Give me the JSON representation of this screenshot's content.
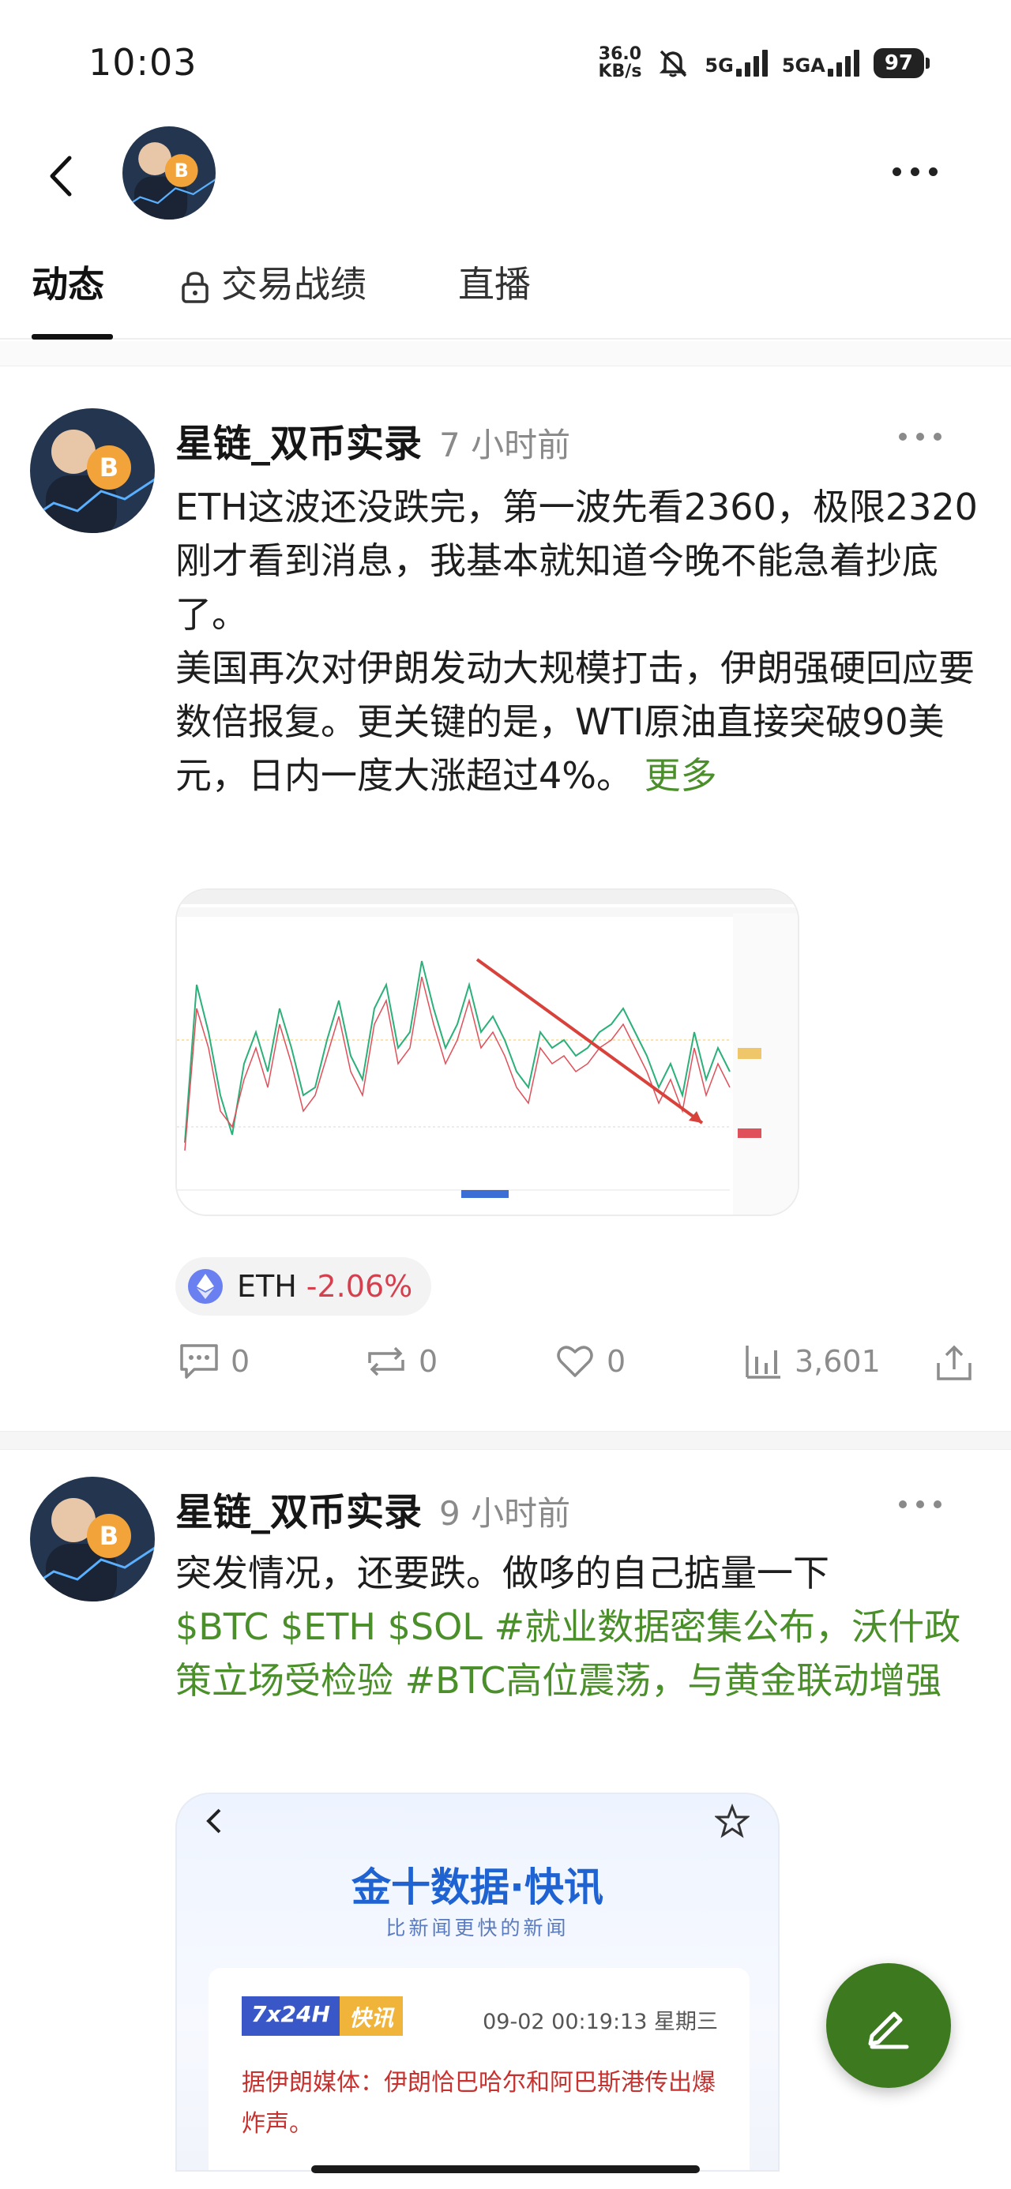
{
  "status_bar": {
    "time": "10:03",
    "net_speed_value": "36.0",
    "net_speed_unit": "KB/s",
    "sim1": "5G",
    "sim2": "5GA",
    "battery": "97"
  },
  "header": {
    "back_icon": "chevron-left-icon",
    "more_icon": "more-horizontal-icon"
  },
  "tabs": [
    {
      "label": "动态",
      "active": true
    },
    {
      "label": "交易战绩",
      "locked": true
    },
    {
      "label": "直播"
    }
  ],
  "posts": [
    {
      "author": "星链_双币实录",
      "time": "7 小时前",
      "lines": [
        "ETH这波还没跌完，第一波先看2360，极限2320",
        "刚才看到消息，我基本就知道今晚不能急着抄底了。",
        "美国再次对伊朗发动大规模打击，伊朗强硬回应要数倍报复。更关键的是，WTI原油直接突破90美元，日内一度大涨超过4%。"
      ],
      "more_label": "更多",
      "coin": {
        "symbol": "ETH",
        "change": "-2.06%",
        "change_color": "#d5404f"
      },
      "actions": {
        "comments": "0",
        "reposts": "0",
        "likes": "0",
        "views": "3,601"
      }
    },
    {
      "author": "星链_双币实录",
      "time": "9 小时前",
      "text": "突发情况，还要跌。做哆的自己掂量一下",
      "tags": "$BTC $ETH $SOL #就业数据密集公布，沃什政策立场受检验 #BTC高位震荡，与黄金联动增强",
      "news_card": {
        "brand": "金十数据·快讯",
        "subtitle": "比新闻更快的新闻",
        "badge_left": "7x24H",
        "badge_right": "快讯",
        "date": "09-02 00:19:13 星期三",
        "headline": "据伊朗媒体：伊朗恰巴哈尔和阿巴斯港传出爆炸声。"
      }
    }
  ],
  "fab": {
    "icon": "edit-pencil-icon"
  },
  "colors": {
    "accent_green": "#4a8f2a",
    "fab_green": "#3d7a1f",
    "down_red": "#d5404f"
  }
}
